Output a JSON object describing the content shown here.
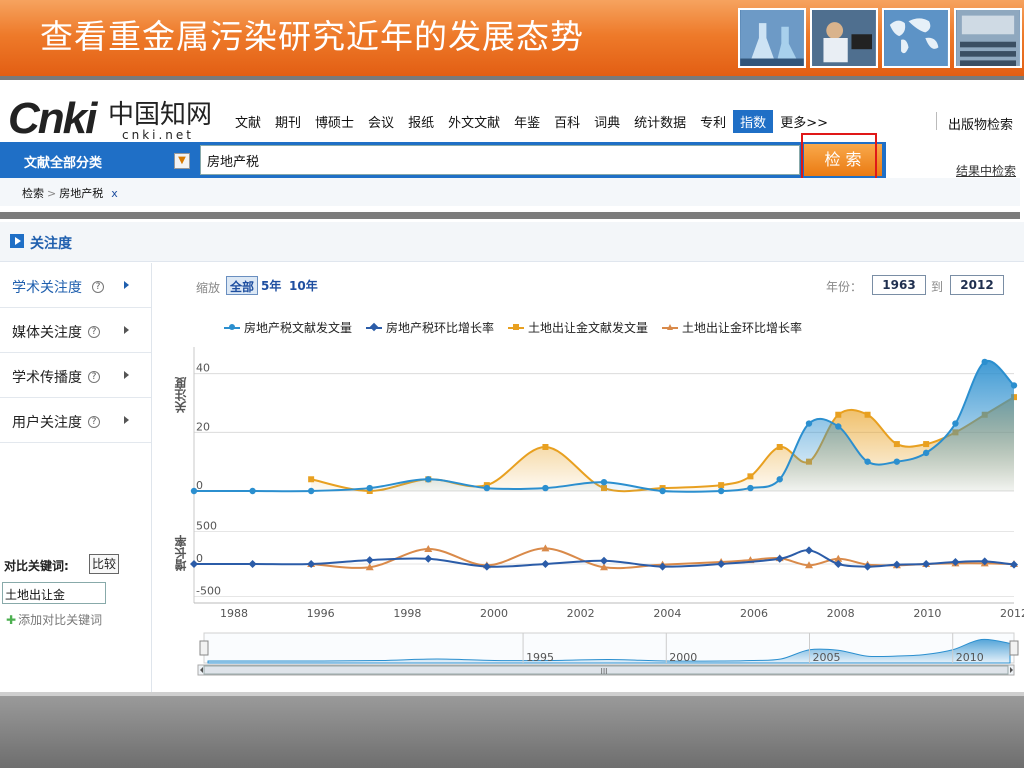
{
  "slide": {
    "title": "查看重金属污染研究近年的发展态势"
  },
  "cnki": {
    "logo_en": "Cnki",
    "logo_cn": "中国知网",
    "logo_url": "cnki.net",
    "nav": [
      "文献",
      "期刊",
      "博硕士",
      "会议",
      "报纸",
      "外文文献",
      "年鉴",
      "百科",
      "词典",
      "统计数据",
      "专利",
      "指数",
      "更多>>"
    ],
    "nav_active": "指数",
    "nav_right": "出版物检索",
    "search": {
      "category": "文献全部分类",
      "query": "房地产税",
      "button": "检 索",
      "in_result": "结果中检索"
    },
    "breadcrumb": {
      "root": "检索",
      "current": "房地产税",
      "close": "x"
    }
  },
  "section": {
    "title": "关注度"
  },
  "sidebar": {
    "items": [
      {
        "label": "学术关注度",
        "help": "?",
        "active": true
      },
      {
        "label": "媒体关注度",
        "help": "?",
        "active": false
      },
      {
        "label": "学术传播度",
        "help": "?",
        "active": false
      },
      {
        "label": "用户关注度",
        "help": "?",
        "active": false
      }
    ],
    "compare_label": "对比关键词:",
    "compare_button": "比较",
    "compare_value": "土地出让金",
    "add_compare": "添加对比关键词"
  },
  "controls": {
    "zoom_label": "缩放",
    "zoom_options": [
      "全部",
      "5年",
      "10年"
    ],
    "zoom_active": "全部",
    "year_label": "年份：",
    "year_from": "1963",
    "to_label": "到",
    "year_to": "2012"
  },
  "chart_data": {
    "type": "line",
    "legend": [
      {
        "name": "房地产税文献发文量",
        "color": "#2b8fcf",
        "marker": "circle"
      },
      {
        "name": "房地产税环比增长率",
        "color": "#2b5ca8",
        "marker": "diamond"
      },
      {
        "name": "土地出让金文献发文量",
        "color": "#e8a020",
        "marker": "square"
      },
      {
        "name": "土地出让金环比增长率",
        "color": "#d98a4a",
        "marker": "triangle"
      }
    ],
    "top_panel": {
      "ylabel": "关注度",
      "yticks": [
        0,
        20,
        40
      ],
      "ylim": [
        0,
        45
      ],
      "series": [
        {
          "name": "房地产税文献发文量",
          "points": [
            [
              1984,
              0
            ],
            [
              1986,
              0
            ],
            [
              1988,
              0
            ],
            [
              1990,
              1
            ],
            [
              1992,
              4
            ],
            [
              1994,
              1
            ],
            [
              1996,
              1
            ],
            [
              1998,
              3
            ],
            [
              2000,
              0
            ],
            [
              2002,
              0
            ],
            [
              2003,
              1
            ],
            [
              2004,
              4
            ],
            [
              2005,
              23
            ],
            [
              2006,
              22
            ],
            [
              2007,
              10
            ],
            [
              2008,
              10
            ],
            [
              2009,
              13
            ],
            [
              2010,
              23
            ],
            [
              2011,
              44
            ],
            [
              2012,
              36
            ]
          ]
        },
        {
          "name": "土地出让金文献发文量",
          "points": [
            [
              1988,
              4
            ],
            [
              1990,
              0
            ],
            [
              1992,
              4
            ],
            [
              1994,
              2
            ],
            [
              1996,
              15
            ],
            [
              1998,
              1
            ],
            [
              2000,
              1
            ],
            [
              2002,
              2
            ],
            [
              2003,
              5
            ],
            [
              2004,
              15
            ],
            [
              2005,
              10
            ],
            [
              2006,
              26
            ],
            [
              2007,
              26
            ],
            [
              2008,
              16
            ],
            [
              2009,
              16
            ],
            [
              2010,
              20
            ],
            [
              2011,
              26
            ],
            [
              2012,
              32
            ]
          ]
        }
      ]
    },
    "bottom_panel": {
      "ylabel": "增长率",
      "yticks": [
        -500,
        0,
        500
      ],
      "ylim": [
        -600,
        600
      ],
      "series": [
        {
          "name": "房地产税环比增长率",
          "points": [
            [
              1984,
              0
            ],
            [
              1986,
              0
            ],
            [
              1988,
              0
            ],
            [
              1990,
              60
            ],
            [
              1992,
              80
            ],
            [
              1994,
              -40
            ],
            [
              1996,
              0
            ],
            [
              1998,
              50
            ],
            [
              2000,
              -40
            ],
            [
              2002,
              0
            ],
            [
              2004,
              80
            ],
            [
              2005,
              210
            ],
            [
              2006,
              0
            ],
            [
              2007,
              -40
            ],
            [
              2008,
              -10
            ],
            [
              2009,
              0
            ],
            [
              2010,
              30
            ],
            [
              2011,
              40
            ],
            [
              2012,
              -10
            ]
          ]
        },
        {
          "name": "土地出让金环比增长率",
          "points": [
            [
              1988,
              0
            ],
            [
              1990,
              -50
            ],
            [
              1992,
              230
            ],
            [
              1994,
              -20
            ],
            [
              1996,
              240
            ],
            [
              1998,
              -50
            ],
            [
              2000,
              -10
            ],
            [
              2002,
              30
            ],
            [
              2003,
              60
            ],
            [
              2004,
              90
            ],
            [
              2005,
              -20
            ],
            [
              2006,
              80
            ],
            [
              2007,
              -10
            ],
            [
              2008,
              -20
            ],
            [
              2009,
              0
            ],
            [
              2010,
              10
            ],
            [
              2011,
              10
            ],
            [
              2012,
              0
            ]
          ]
        }
      ]
    },
    "xlim": [
      1984,
      2012
    ],
    "xticks": [
      1988,
      1996,
      1998,
      2000,
      2002,
      2004,
      2006,
      2008,
      2010,
      2012
    ],
    "navigator_labels": [
      "1995",
      "2000",
      "2005",
      "2010"
    ],
    "navigator_ticks": [
      1995,
      2000,
      2005,
      2010
    ],
    "navigator_handle": "III"
  },
  "colors": {
    "accent": "#1f6fc6",
    "title_band": "#ee7a2a",
    "highlight_box": "#e01818"
  }
}
